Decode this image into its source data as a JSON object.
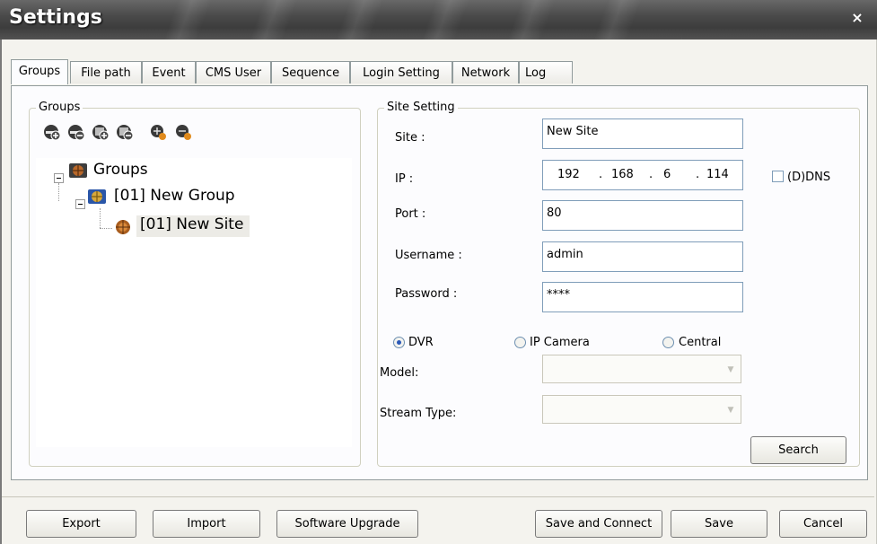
{
  "window": {
    "title": "Settings",
    "close_symbol": "×"
  },
  "tabs": [
    {
      "label": "Groups",
      "active": true
    },
    {
      "label": "File path"
    },
    {
      "label": "Event"
    },
    {
      "label": "CMS User"
    },
    {
      "label": "Sequence"
    },
    {
      "label": "Login Setting"
    },
    {
      "label": "Network"
    },
    {
      "label": "Log"
    }
  ],
  "groups_panel": {
    "legend": "Groups",
    "toolbar_icons": [
      "add-group-icon",
      "remove-group-icon",
      "add-site-icon",
      "remove-site-icon",
      "import-site-icon",
      "export-site-icon"
    ],
    "tree": {
      "root": "Groups",
      "group": "[01] New Group",
      "site": "[01] New Site"
    }
  },
  "site_setting": {
    "legend": "Site Setting",
    "site_label": "Site :",
    "site_value": "New Site",
    "ip_label": "IP :",
    "ip_octets": [
      "192",
      "168",
      "6",
      "114"
    ],
    "ip_dots": ".",
    "ddns_label": "(D)DNS",
    "port_label": "Port :",
    "port_value": "80",
    "username_label": "Username :",
    "username_value": "admin",
    "password_label": "Password :",
    "password_value": "****",
    "device_types": [
      "DVR",
      "IP Camera",
      "Central"
    ],
    "selected_type": "DVR",
    "model_label": "Model:",
    "stream_label": "Stream Type:",
    "search_label": "Search"
  },
  "footer": {
    "export_label": "Export",
    "import_label": "Import",
    "upgrade_label": "Software Upgrade",
    "save_connect_label": "Save and Connect",
    "save_label": "Save",
    "cancel_label": "Cancel"
  },
  "colors": {
    "title_bar": "#4a4a4a",
    "field_border": "#7f9db9",
    "radio_dot": "#2a58b8"
  }
}
